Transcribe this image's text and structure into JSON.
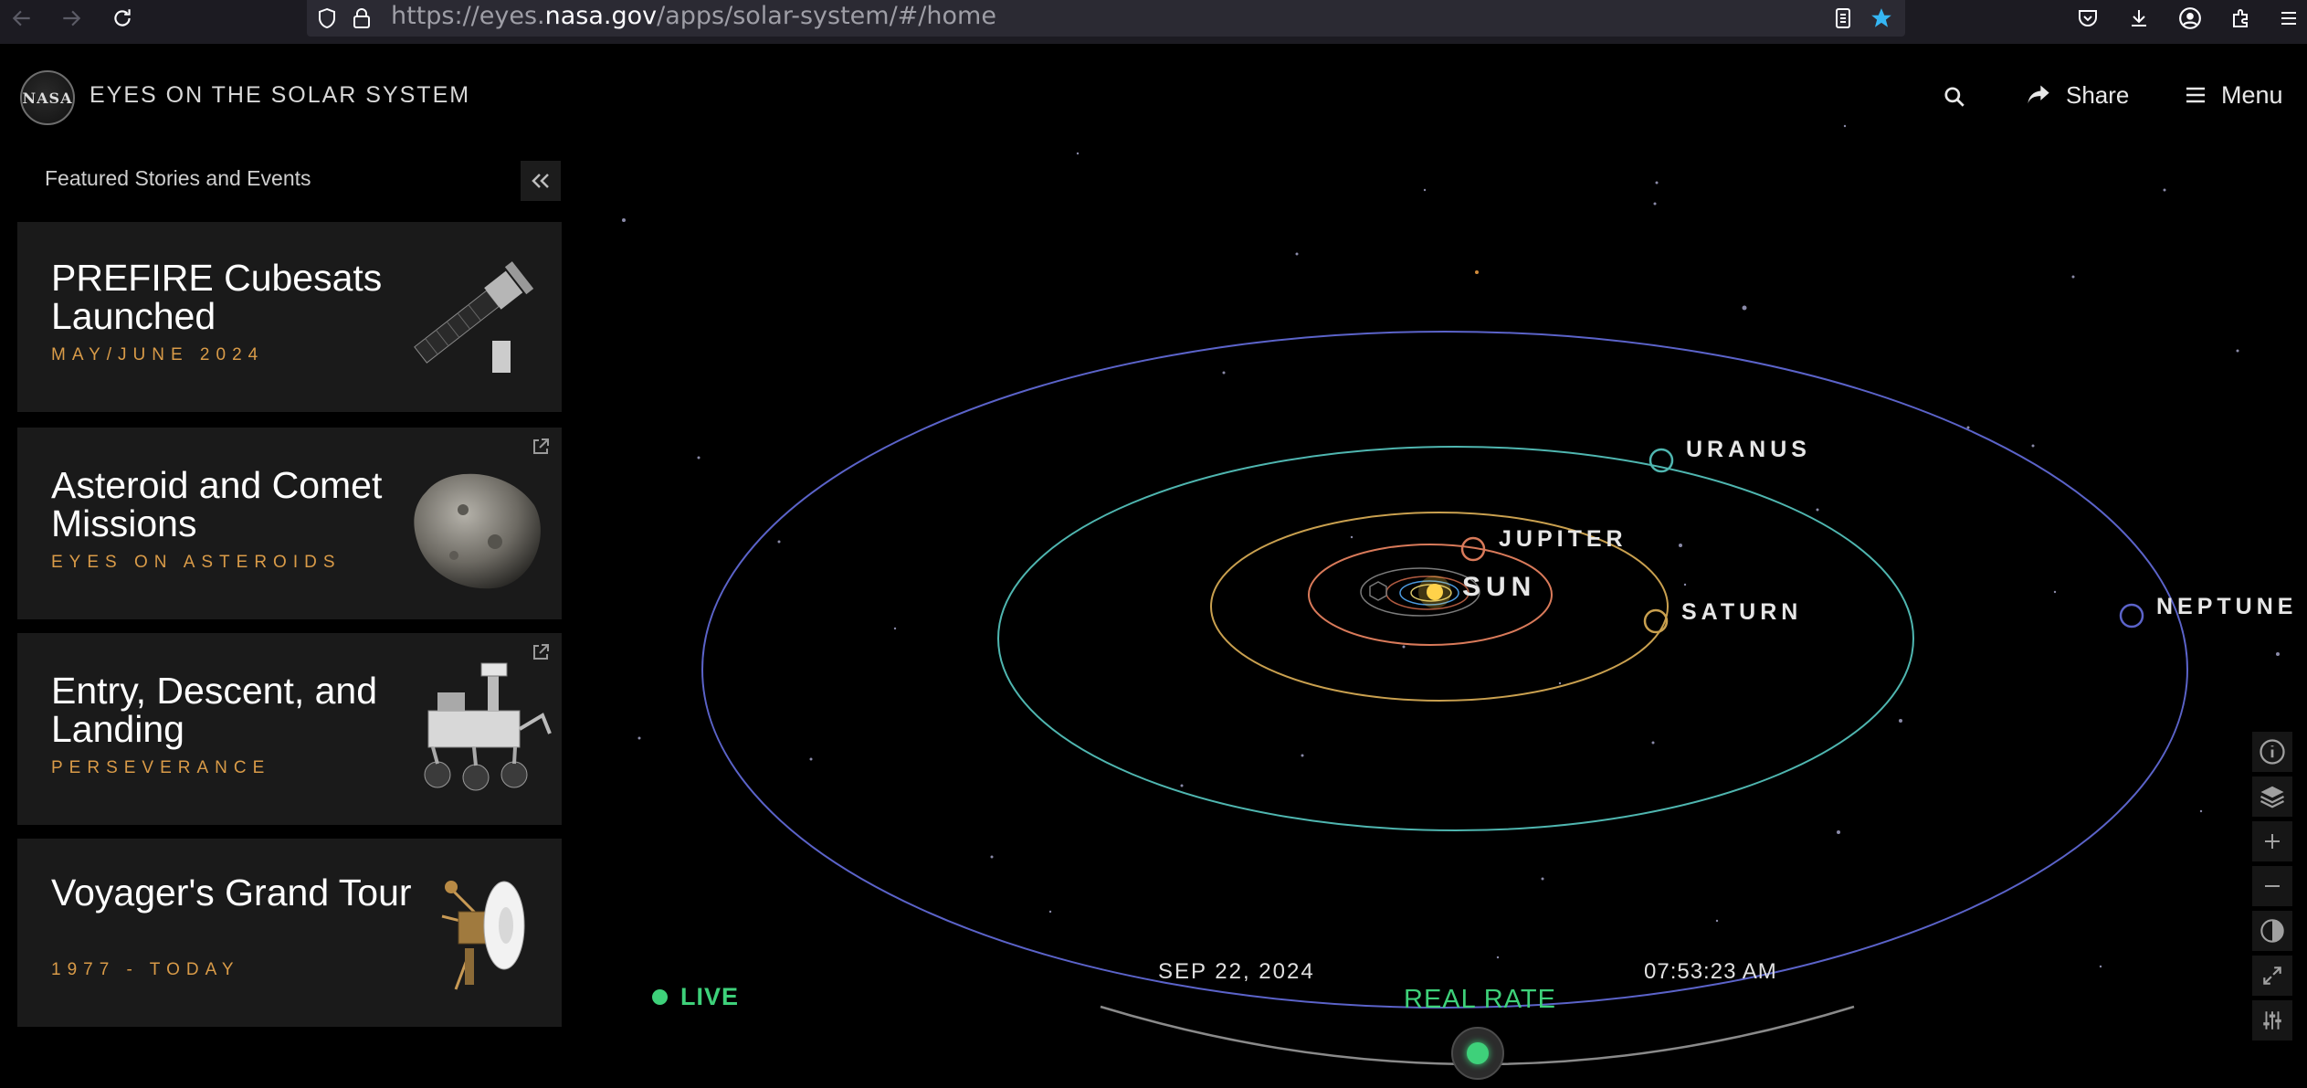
{
  "browser": {
    "url_prefix": "https://eyes.",
    "url_domain": "nasa.gov",
    "url_suffix": "/apps/solar-system/#/home",
    "icons": [
      "back-arrow-icon",
      "forward-arrow-icon",
      "reload-icon",
      "shield-icon",
      "lock-icon",
      "reader-view-icon",
      "bookmark-star-icon",
      "pocket-icon",
      "download-icon",
      "account-icon",
      "extensions-icon",
      "hamburger-menu-icon"
    ]
  },
  "header": {
    "logo_text": "NASA",
    "title": "EYES ON THE SOLAR SYSTEM",
    "share_label": "Share",
    "menu_label": "Menu"
  },
  "sidebar": {
    "title": "Featured Stories and Events",
    "cards": [
      {
        "title": "PREFIRE Cubesats Launched",
        "subtitle": "MAY/JUNE 2024",
        "image": "cubesat-image",
        "external": false
      },
      {
        "title": "Asteroid and Comet Missions",
        "subtitle": "EYES ON ASTEROIDS",
        "image": "asteroid-image",
        "external": true
      },
      {
        "title": "Entry, Descent, and Landing",
        "subtitle": "PERSEVERANCE",
        "image": "rover-image",
        "external": true
      },
      {
        "title": "Voyager's Grand Tour",
        "subtitle": "1977 - TODAY",
        "image": "voyager-image",
        "external": false
      }
    ]
  },
  "solar_system": {
    "labels": {
      "sun": "SUN",
      "jupiter": "JUPITER",
      "saturn": "SATURN",
      "uranus": "URANUS",
      "neptune": "NEPTUNE"
    },
    "colors": {
      "neptune": "#5b63c9",
      "uranus": "#4fb6b0",
      "saturn": "#c9a04f",
      "jupiter": "#d97a5a",
      "sun": "#ffd24a"
    }
  },
  "controls": {
    "right": [
      "info-icon",
      "layers-icon",
      "zoom-in-icon",
      "zoom-out-icon",
      "lighting-icon",
      "fullscreen-icon",
      "settings-sliders-icon"
    ]
  },
  "time": {
    "live_label": "LIVE",
    "date": "SEP 22, 2024",
    "time": "07:53:23 AM",
    "rate": "REAL RATE",
    "accent": "#3ed17a"
  }
}
